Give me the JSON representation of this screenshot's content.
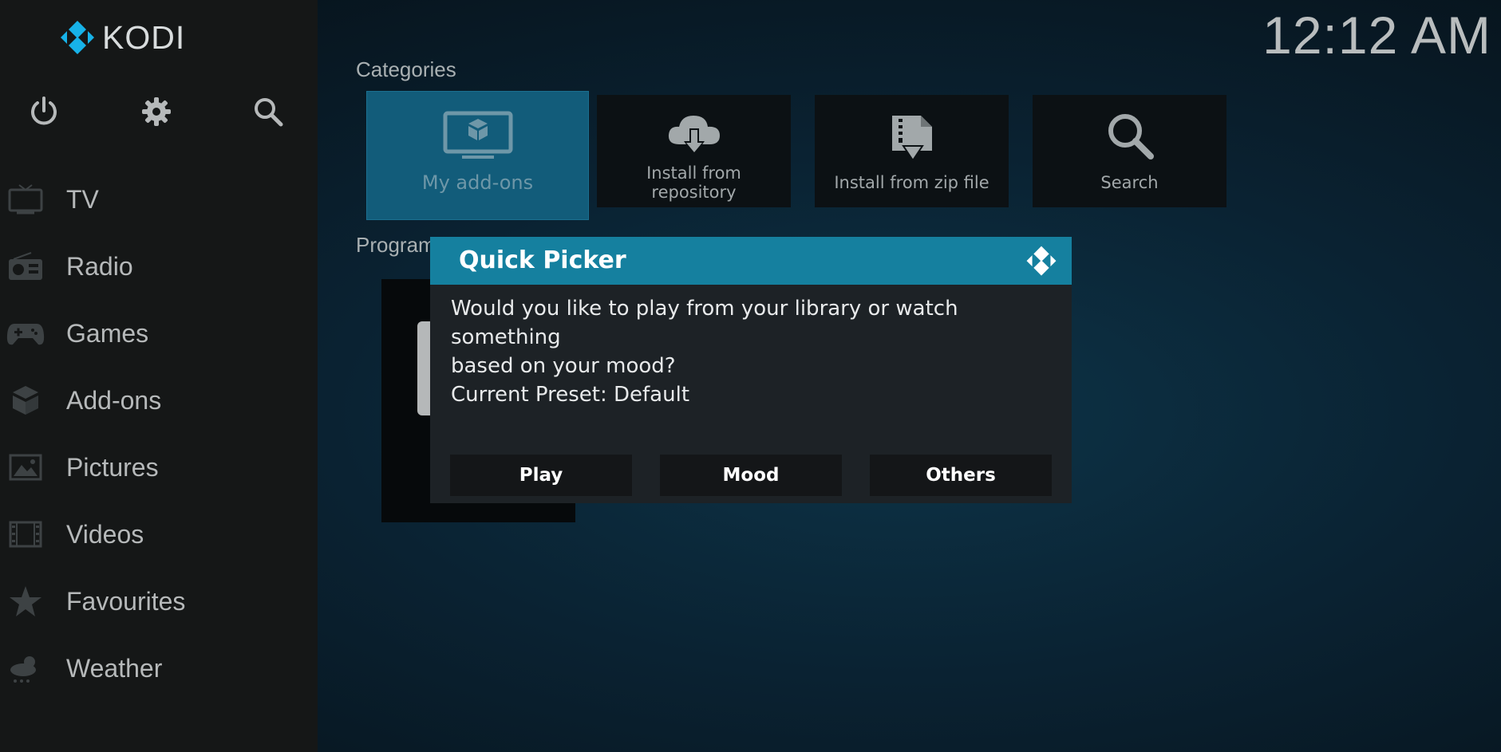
{
  "app": {
    "logo_text": "KODI",
    "clock": "12:12 AM"
  },
  "top_icons": [
    "power-icon",
    "gear-icon",
    "search-icon"
  ],
  "sidebar": {
    "items": [
      {
        "label": "TV",
        "icon": "tv-icon"
      },
      {
        "label": "Radio",
        "icon": "radio-icon"
      },
      {
        "label": "Games",
        "icon": "gamepad-icon"
      },
      {
        "label": "Add-ons",
        "icon": "addons-box-icon"
      },
      {
        "label": "Pictures",
        "icon": "picture-icon"
      },
      {
        "label": "Videos",
        "icon": "film-icon"
      },
      {
        "label": "Favourites",
        "icon": "star-icon"
      },
      {
        "label": "Weather",
        "icon": "weather-icon"
      }
    ]
  },
  "categories": {
    "title": "Categories",
    "tiles": [
      {
        "label": "My add-ons",
        "icon": "monitor-box-icon",
        "focused": true
      },
      {
        "label": "Install from repository",
        "icon": "cloud-download-icon"
      },
      {
        "label": "Install from zip file",
        "icon": "zip-download-icon"
      },
      {
        "label": "Search",
        "icon": "search-icon"
      }
    ]
  },
  "program_addons": {
    "title_visible": "Program"
  },
  "dialog": {
    "title": "Quick Picker",
    "message_line1": "Would you like to play from your library or watch something",
    "message_line2": "based on your mood?",
    "message_line3": "Current Preset: Default",
    "buttons": {
      "play": "Play",
      "mood": "Mood",
      "others": "Others"
    }
  },
  "colors": {
    "accent": "#15809f",
    "focused_tile": "#125c7a",
    "sidebar_bg": "#151717",
    "dialog_bg": "#1d2226"
  }
}
